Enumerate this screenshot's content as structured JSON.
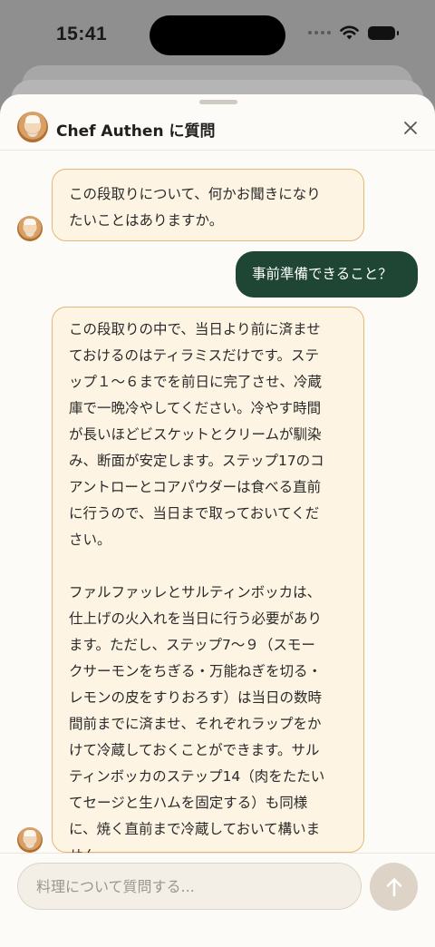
{
  "status_bar": {
    "time": "15:41"
  },
  "header": {
    "title": "Chef Authen に質問",
    "close_icon": "close-icon",
    "avatar_icon": "chef-avatar-icon"
  },
  "messages": [
    {
      "role": "assistant",
      "lines": [
        "この段取りについて、何かお聞きになり",
        "たいことはありますか。"
      ]
    },
    {
      "role": "user",
      "lines": [
        "事前準備できること？"
      ]
    },
    {
      "role": "assistant",
      "lines": [
        "この段取りの中で、当日より前に済ませ",
        "ておけるのはティラミスだけです。ステ",
        "ップ１〜６までを前日に完了させ、冷蔵",
        "庫で一晩冷やしてください。冷やす時間",
        "が長いほどビスケットとクリームが馴染",
        "み、断面が安定します。ステップ17のコ",
        "アントローとコアパウダーは食べる直前",
        "に行うので、当日まで取っておいてくだ",
        "さい。",
        "",
        "ファルファッレとサルティンボッカは、",
        "仕上げの火入れを当日に行う必要があり",
        "ます。ただし、ステップ7〜９（スモー",
        "クサーモンをちぎる・万能ねぎを切る・",
        "レモンの皮をすりおろす）は当日の数時",
        "間前までに済ませ、それぞれラップをか",
        "けて冷蔵しておくことができます。サル",
        "ティンボッカのステップ14（肉をたたい",
        "てセージと生ハムを固定する）も同様",
        "に、焼く直前まで冷蔵しておいて構いま",
        "せん。"
      ]
    }
  ],
  "input": {
    "placeholder": "料理について質問する...",
    "value": ""
  },
  "send_button": {
    "icon": "arrow-up-icon"
  },
  "colors": {
    "assistant_bubble_bg": "#fdf4e3",
    "assistant_bubble_border": "#e3b877",
    "user_bubble_bg": "#1f4635",
    "sheet_bg": "#fdfbf7",
    "send_button_bg": "#ddd3c7"
  }
}
